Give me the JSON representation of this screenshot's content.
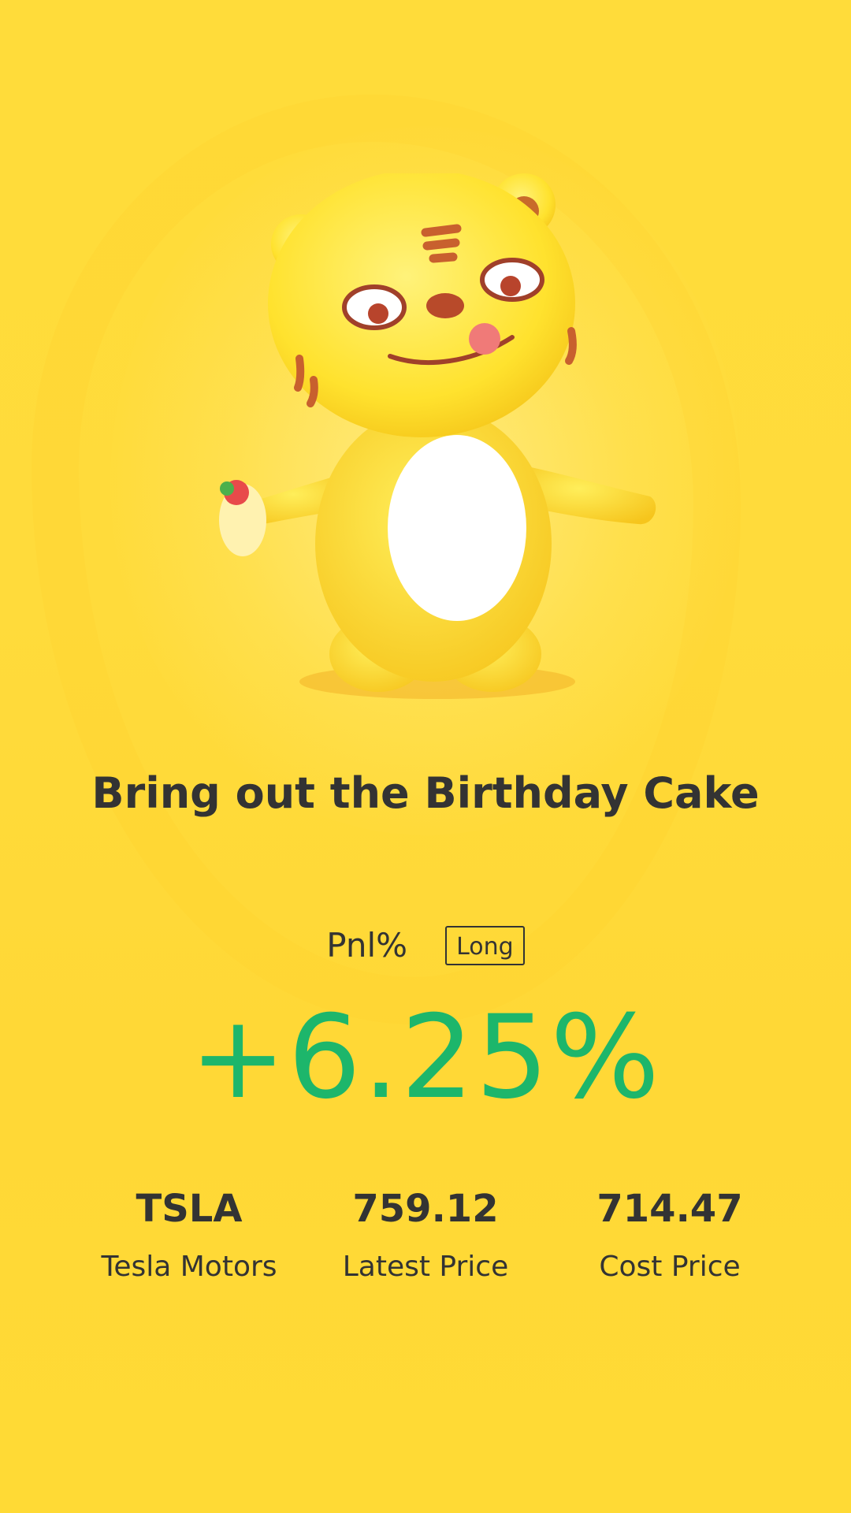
{
  "headline": "Bring out the Birthday Cake",
  "pnl": {
    "label": "Pnl%",
    "position_badge": "Long",
    "value": "+6.25%"
  },
  "stats": [
    {
      "value": "TSLA",
      "label": "Tesla Motors"
    },
    {
      "value": "759.12",
      "label": "Latest Price"
    },
    {
      "value": "714.47",
      "label": "Cost Price"
    }
  ],
  "colors": {
    "background": "#FFDB3B",
    "text": "#333333",
    "gain": "#1DB66B"
  },
  "illustration": "tiger-mascot-icon"
}
